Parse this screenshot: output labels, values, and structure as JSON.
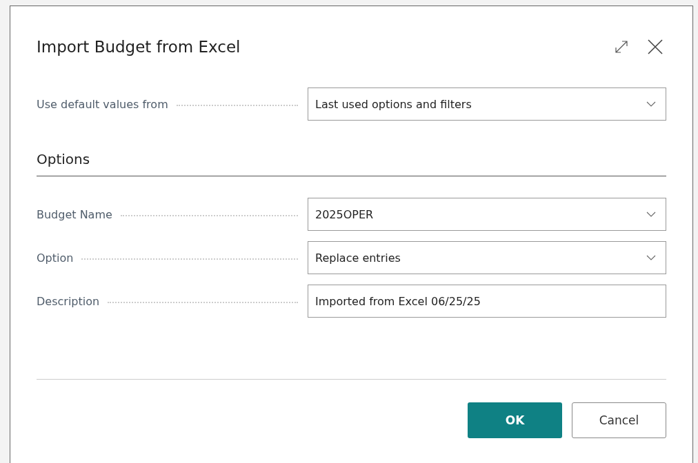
{
  "dialog": {
    "title": "Import Budget from Excel"
  },
  "defaults": {
    "label": "Use default values from",
    "value": "Last used options and filters",
    "kind": "dropdown"
  },
  "section": {
    "title": "Options"
  },
  "fields": [
    {
      "label": "Budget Name",
      "value": "2025OPER",
      "kind": "dropdown"
    },
    {
      "label": "Option",
      "value": "Replace entries",
      "kind": "dropdown"
    },
    {
      "label": "Description",
      "value": "Imported from Excel 06/25/25",
      "kind": "text"
    }
  ],
  "buttons": [
    {
      "label": "OK",
      "kind": "primary"
    },
    {
      "label": "Cancel",
      "kind": "secondary"
    }
  ]
}
